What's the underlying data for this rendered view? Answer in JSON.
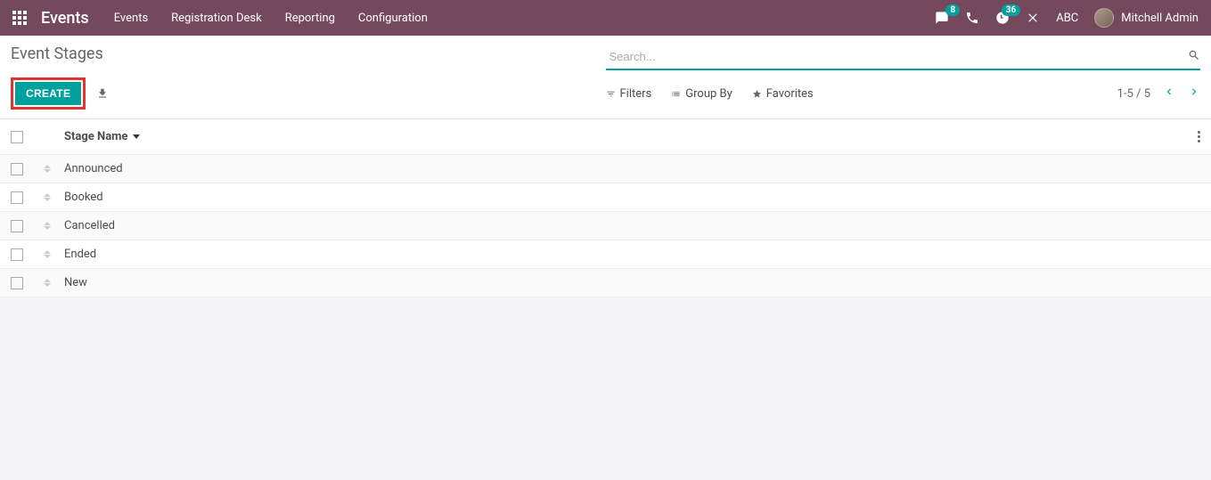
{
  "nav": {
    "brand": "Events",
    "links": [
      "Events",
      "Registration Desk",
      "Reporting",
      "Configuration"
    ],
    "chat_badge": "8",
    "clock_badge": "36",
    "abc": "ABC",
    "user": "Mitchell Admin"
  },
  "page": {
    "title": "Event Stages",
    "search_placeholder": "Search..."
  },
  "toolbar": {
    "create_label": "CREATE",
    "filters": "Filters",
    "group_by": "Group By",
    "favorites": "Favorites",
    "pager": "1-5 / 5"
  },
  "table": {
    "header": "Stage Name",
    "rows": [
      "Announced",
      "Booked",
      "Cancelled",
      "Ended",
      "New"
    ]
  }
}
